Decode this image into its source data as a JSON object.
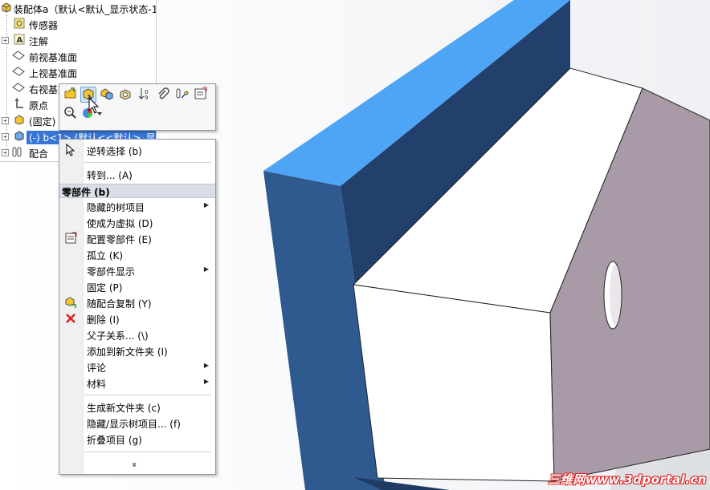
{
  "tree": {
    "root_label": "装配体a（默认<默认_显示状态-1",
    "items": [
      {
        "label": "传感器",
        "icon": "sensor-icon"
      },
      {
        "label": "注解",
        "icon": "annotation-icon"
      },
      {
        "label": "前视基准面",
        "icon": "plane-icon"
      },
      {
        "label": "上视基准面",
        "icon": "plane-icon"
      },
      {
        "label": "右视基准面",
        "icon": "plane-icon"
      },
      {
        "label": "原点",
        "icon": "origin-icon"
      },
      {
        "label": "(固定)",
        "icon": "part-icon"
      },
      {
        "label": "(-) b<1> (默认<<默认>_显示",
        "icon": "part-icon",
        "selected": true
      },
      {
        "label": "配合",
        "icon": "mates-icon"
      }
    ]
  },
  "toolbar": {
    "buttons": [
      "open-part-icon",
      "edit-part-icon",
      "assembly-icon",
      "component-properties-icon",
      "sort-icon",
      "paperclip-icon",
      "smart-mate-icon",
      "configuration-icon",
      "zoom-to-selection-icon",
      "appearance-icon"
    ]
  },
  "context_menu": {
    "top_items": [
      {
        "label": "逆转选择 (b)",
        "icon": "cursor-icon"
      },
      {
        "label": "转到... (A)"
      }
    ],
    "header": "零部件 (b)",
    "items": [
      {
        "label": "隐藏的树项目",
        "submenu": true
      },
      {
        "label": "使成为虚拟 (D)"
      },
      {
        "label": "配置零部件 (E)",
        "icon": "config-component-icon"
      },
      {
        "label": "孤立 (K)"
      },
      {
        "label": "零部件显示",
        "submenu": true
      },
      {
        "label": "固定 (P)"
      },
      {
        "label": "随配合复制 (Y)",
        "icon": "copy-with-mates-icon"
      },
      {
        "label": "删除 (I)",
        "icon": "delete-icon"
      },
      {
        "label": "父子关系... (\\)"
      },
      {
        "label": "添加到新文件夹 (I)"
      },
      {
        "label": "评论",
        "submenu": true
      },
      {
        "label": "材料",
        "submenu": true
      }
    ],
    "bottom_items": [
      {
        "label": "生成新文件夹 (c)"
      },
      {
        "label": "隐藏/显示树项目... (f)"
      },
      {
        "label": "折叠项目 (g)"
      }
    ],
    "more": "»"
  },
  "watermark": "三维网www.3dportal.cn",
  "colors": {
    "selection": "#3875d7",
    "face_top_blue": "#4ea4f5",
    "face_side_navy": "#2c4f82",
    "face_dark_navy": "#1f3a63",
    "face_white": "#ffffff",
    "face_lilac": "#a99aa8",
    "watermark_red": "#e02020"
  }
}
